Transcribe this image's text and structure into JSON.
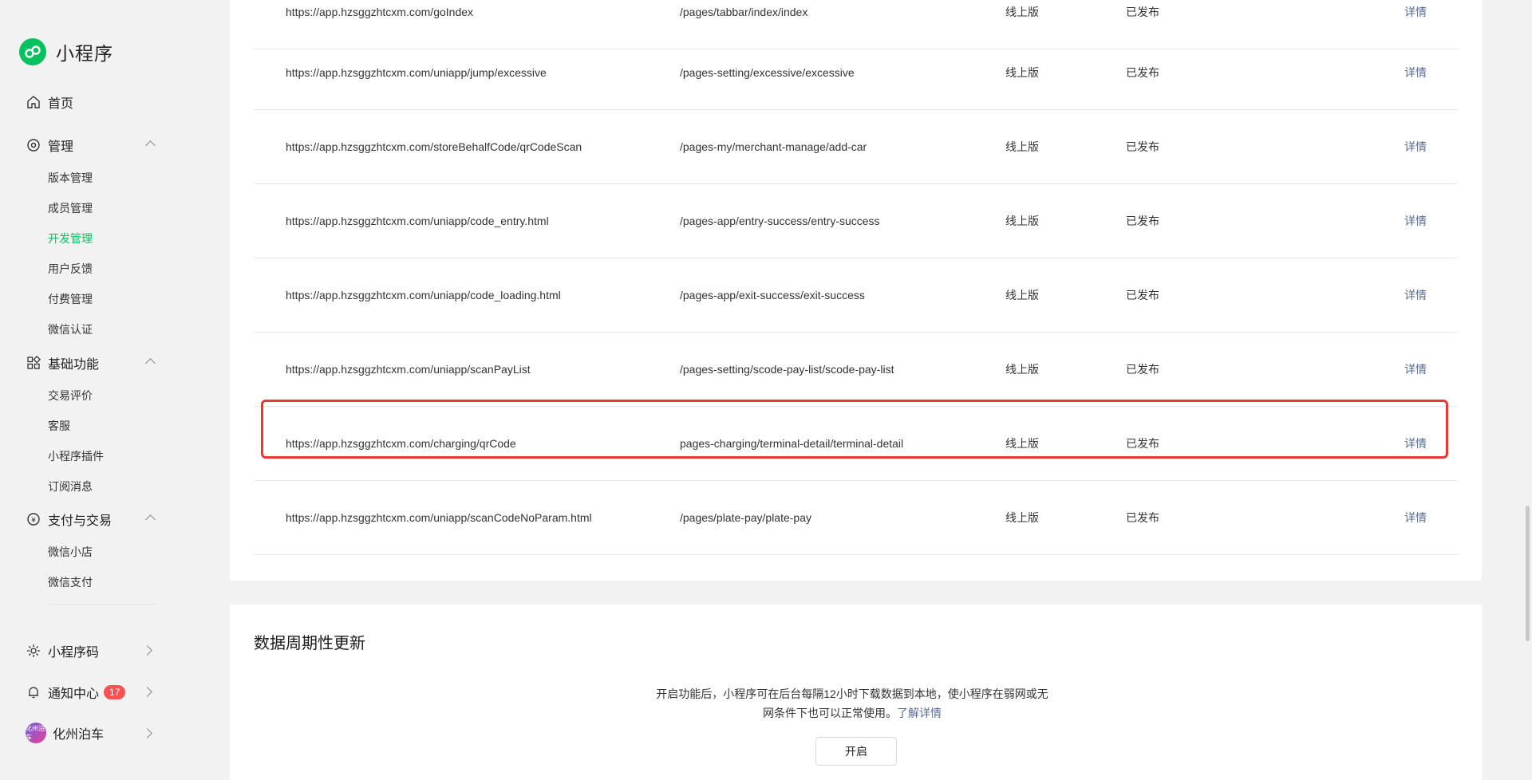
{
  "sidebar": {
    "brand": "小程序",
    "home": "首页",
    "manage": {
      "label": "管理",
      "items": [
        "版本管理",
        "成员管理",
        "开发管理",
        "用户反馈",
        "付费管理",
        "微信认证"
      ]
    },
    "basic": {
      "label": "基础功能",
      "items": [
        "交易评价",
        "客服",
        "小程序插件",
        "订阅消息"
      ]
    },
    "pay": {
      "label": "支付与交易",
      "items": [
        "微信小店",
        "微信支付"
      ]
    },
    "qrcode": "小程序码",
    "notify": {
      "label": "通知中心",
      "badge": "17"
    },
    "account": {
      "name": "化州泊车",
      "avatar_text": "化州泊车"
    },
    "accent_color": "#07c160"
  },
  "table": {
    "rows": [
      {
        "url": "https://app.hzsggzhtcxm.com/goIndex",
        "path": "/pages/tabbar/index/index",
        "version": "线上版",
        "status": "已发布",
        "action": "详情"
      },
      {
        "url": "https://app.hzsggzhtcxm.com/uniapp/jump/excessive",
        "path": "/pages-setting/excessive/excessive",
        "version": "线上版",
        "status": "已发布",
        "action": "详情"
      },
      {
        "url": "https://app.hzsggzhtcxm.com/storeBehalfCode/qrCodeScan",
        "path": "/pages-my/merchant-manage/add-car",
        "version": "线上版",
        "status": "已发布",
        "action": "详情"
      },
      {
        "url": "https://app.hzsggzhtcxm.com/uniapp/code_entry.html",
        "path": "/pages-app/entry-success/entry-success",
        "version": "线上版",
        "status": "已发布",
        "action": "详情"
      },
      {
        "url": "https://app.hzsggzhtcxm.com/uniapp/code_loading.html",
        "path": "/pages-app/exit-success/exit-success",
        "version": "线上版",
        "status": "已发布",
        "action": "详情"
      },
      {
        "url": "https://app.hzsggzhtcxm.com/uniapp/scanPayList",
        "path": "/pages-setting/scode-pay-list/scode-pay-list",
        "version": "线上版",
        "status": "已发布",
        "action": "详情"
      },
      {
        "url": "https://app.hzsggzhtcxm.com/charging/qrCode",
        "path": "pages-charging/terminal-detail/terminal-detail",
        "version": "线上版",
        "status": "已发布",
        "action": "详情"
      },
      {
        "url": "https://app.hzsggzhtcxm.com/uniapp/scanCodeNoParam.html",
        "path": "/pages/plate-pay/plate-pay",
        "version": "线上版",
        "status": "已发布",
        "action": "详情"
      }
    ],
    "highlight_color": "#e53935",
    "link_color": "#576b95"
  },
  "update": {
    "title": "数据周期性更新",
    "desc_line1": "开启功能后，小程序可在后台每隔12小时下载数据到本地，使小程序在弱网或无",
    "desc_line2": "网条件下也可以正常使用。",
    "learn_more": "了解详情",
    "button": "开启"
  }
}
